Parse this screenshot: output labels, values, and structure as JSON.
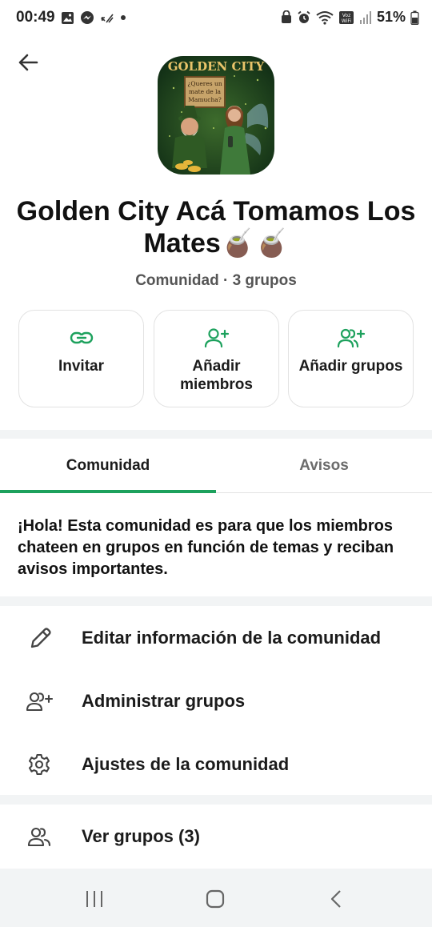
{
  "status_bar": {
    "time": "00:49",
    "battery": "51%",
    "icons": [
      "gallery-icon",
      "messenger-icon",
      "missed-call-icon",
      "dot-icon",
      "lock-icon",
      "alarm-icon",
      "wifi-icon",
      "vowifi-icon",
      "signal-icon",
      "battery-icon"
    ]
  },
  "header": {
    "back_icon": "arrow-left-icon"
  },
  "community": {
    "avatar_text_top": "GOLDEN CITY",
    "avatar_text_sign": "¿Queres un mate de la Mamucha?",
    "title": "Golden City Acá Tomamos Los Mates🧉🧉",
    "subtitle": "Comunidad · 3 grupos"
  },
  "actions": [
    {
      "label": "Invitar",
      "icon": "link-icon"
    },
    {
      "label": "Añadir miembros",
      "icon": "add-person-icon"
    },
    {
      "label": "Añadir grupos",
      "icon": "add-group-icon"
    }
  ],
  "tabs": [
    {
      "label": "Comunidad",
      "active": true
    },
    {
      "label": "Avisos",
      "active": false
    }
  ],
  "description": "¡Hola! Esta comunidad es para que los miembros chateen en grupos en función de temas y reciban avisos importantes.",
  "menu": [
    {
      "label": "Editar información de la comunidad",
      "icon": "pencil-icon"
    },
    {
      "label": "Administrar grupos",
      "icon": "manage-groups-icon"
    },
    {
      "label": "Ajustes de la comunidad",
      "icon": "gear-icon"
    },
    {
      "label": "Ver grupos (3)",
      "icon": "groups-icon"
    }
  ],
  "nav": {
    "icons": [
      "recent-apps-icon",
      "home-icon",
      "back-nav-icon"
    ]
  },
  "colors": {
    "accent": "#1da15d",
    "band": "#f2f4f5"
  }
}
